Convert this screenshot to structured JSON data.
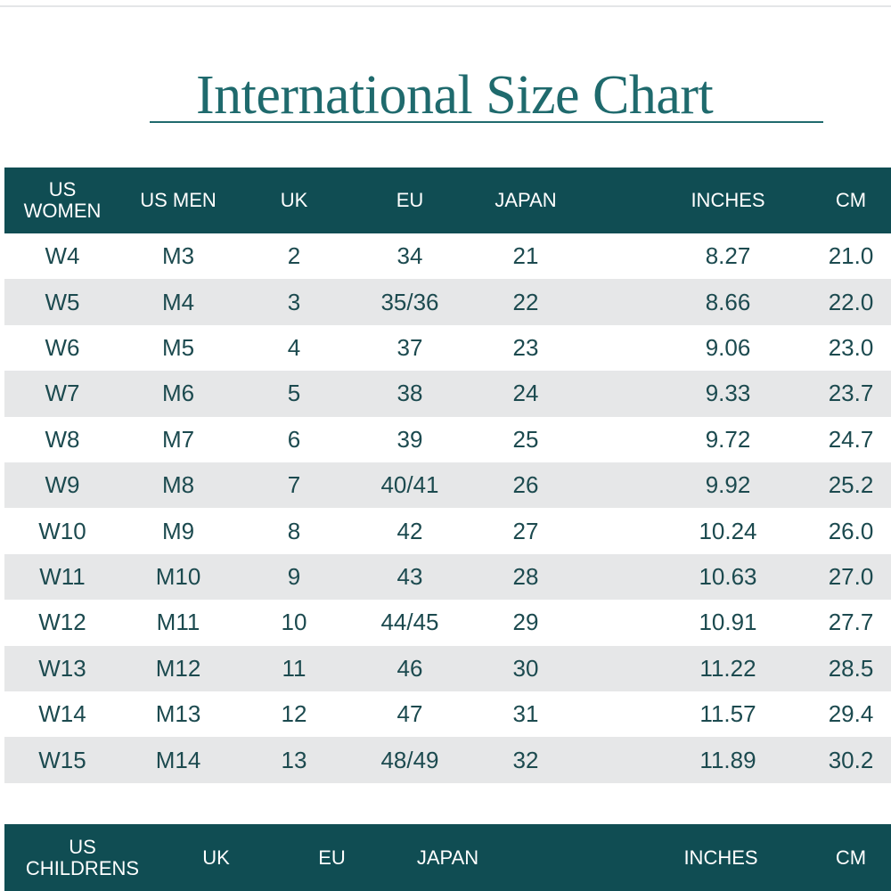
{
  "title": "International Size Chart",
  "adult_table": {
    "headers": {
      "us_women_line1": "US",
      "us_women_line2": "WOMEN",
      "us_men": "US MEN",
      "uk": "UK",
      "eu": "EU",
      "japan": "JAPAN",
      "inches": "INCHES",
      "cm": "CM"
    },
    "rows": [
      [
        "W4",
        "M3",
        "2",
        "34",
        "21",
        "8.27",
        "21.0"
      ],
      [
        "W5",
        "M4",
        "3",
        "35/36",
        "22",
        "8.66",
        "22.0"
      ],
      [
        "W6",
        "M5",
        "4",
        "37",
        "23",
        "9.06",
        "23.0"
      ],
      [
        "W7",
        "M6",
        "5",
        "38",
        "24",
        "9.33",
        "23.7"
      ],
      [
        "W8",
        "M7",
        "6",
        "39",
        "25",
        "9.72",
        "24.7"
      ],
      [
        "W9",
        "M8",
        "7",
        "40/41",
        "26",
        "9.92",
        "25.2"
      ],
      [
        "W10",
        "M9",
        "8",
        "42",
        "27",
        "10.24",
        "26.0"
      ],
      [
        "W11",
        "M10",
        "9",
        "43",
        "28",
        "10.63",
        "27.0"
      ],
      [
        "W12",
        "M11",
        "10",
        "44/45",
        "29",
        "10.91",
        "27.7"
      ],
      [
        "W13",
        "M12",
        "11",
        "46",
        "30",
        "11.22",
        "28.5"
      ],
      [
        "W14",
        "M13",
        "12",
        "47",
        "31",
        "11.57",
        "29.4"
      ],
      [
        "W15",
        "M14",
        "13",
        "48/49",
        "32",
        "11.89",
        "30.2"
      ]
    ]
  },
  "children_table": {
    "headers": {
      "us_children_line1": "US",
      "us_children_line2": "CHILDRENS",
      "uk": "UK",
      "eu": "EU",
      "japan": "JAPAN",
      "inches": "INCHES",
      "cm": "CM"
    }
  },
  "colors": {
    "header_bg": "#104d53",
    "title": "#1f6a6d",
    "cell_text": "#1c4a4f",
    "row_shade": "#e6e7e8"
  }
}
